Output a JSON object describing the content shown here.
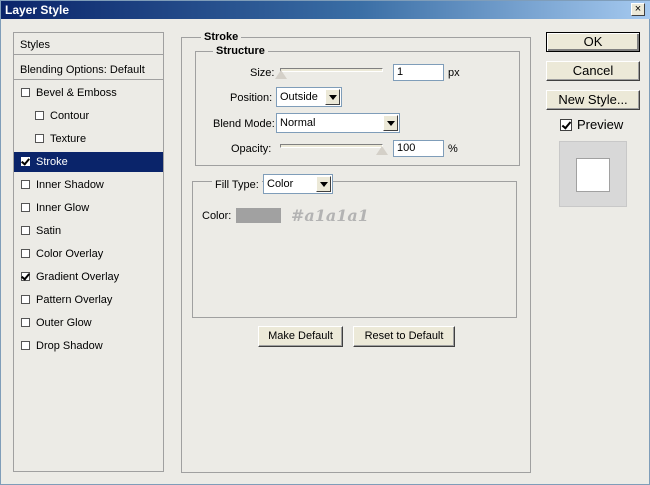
{
  "window": {
    "title": "Layer Style",
    "close_glyph": "×"
  },
  "sidebar": {
    "header": "Styles",
    "blending": "Blending Options: Default",
    "items": [
      {
        "label": "Bevel & Emboss",
        "checked": false,
        "indent": false,
        "selected": false
      },
      {
        "label": "Contour",
        "checked": false,
        "indent": true,
        "selected": false
      },
      {
        "label": "Texture",
        "checked": false,
        "indent": true,
        "selected": false
      },
      {
        "label": "Stroke",
        "checked": true,
        "indent": false,
        "selected": true
      },
      {
        "label": "Inner Shadow",
        "checked": false,
        "indent": false,
        "selected": false
      },
      {
        "label": "Inner Glow",
        "checked": false,
        "indent": false,
        "selected": false
      },
      {
        "label": "Satin",
        "checked": false,
        "indent": false,
        "selected": false
      },
      {
        "label": "Color Overlay",
        "checked": false,
        "indent": false,
        "selected": false
      },
      {
        "label": "Gradient Overlay",
        "checked": true,
        "indent": false,
        "selected": false
      },
      {
        "label": "Pattern Overlay",
        "checked": false,
        "indent": false,
        "selected": false
      },
      {
        "label": "Outer Glow",
        "checked": false,
        "indent": false,
        "selected": false
      },
      {
        "label": "Drop Shadow",
        "checked": false,
        "indent": false,
        "selected": false
      }
    ]
  },
  "actions": {
    "ok": "OK",
    "cancel": "Cancel",
    "new_style": "New Style...",
    "preview_label": "Preview",
    "preview_checked": true
  },
  "stroke": {
    "group_title": "Stroke",
    "structure_title": "Structure",
    "size_label": "Size:",
    "size_value": "1",
    "size_unit": "px",
    "position_label": "Position:",
    "position_value": "Outside",
    "blend_label": "Blend Mode:",
    "blend_value": "Normal",
    "opacity_label": "Opacity:",
    "opacity_value": "100",
    "opacity_unit": "%",
    "fill_type_label": "Fill Type:",
    "fill_type_value": "Color",
    "color_label": "Color:",
    "color_hex_value": "#a1a1a1",
    "color_annotation": "#a1a1a1",
    "make_default": "Make Default",
    "reset_default": "Reset to Default"
  },
  "colors": {
    "selection": "#0a246a",
    "swatch": "#a1a1a1"
  }
}
